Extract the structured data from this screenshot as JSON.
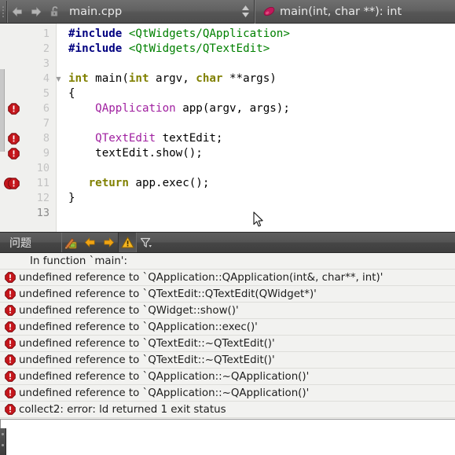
{
  "toolbar": {
    "back_icon": "arrow-left-icon",
    "forward_icon": "arrow-right-icon",
    "lock_icon": "unlocked-padlock-icon",
    "file_name": "main.cpp",
    "file_dropdown_icon": "updown-spinner-icon",
    "symbol_icon": "function-symbol-icon",
    "symbol_name": "main(int, char **): int"
  },
  "editor": {
    "current_line": 13,
    "fold_marker_line": 4,
    "error_lines": [
      6,
      8,
      9,
      11
    ],
    "double_error_lines": [
      11
    ],
    "lines": [
      {
        "n": 1,
        "tokens": [
          {
            "t": "#include ",
            "c": "tok-pp"
          },
          {
            "t": "<QtWidgets/QApplication>",
            "c": "tok-str"
          }
        ]
      },
      {
        "n": 2,
        "tokens": [
          {
            "t": "#include ",
            "c": "tok-pp"
          },
          {
            "t": "<QtWidgets/QTextEdit>",
            "c": "tok-str"
          }
        ]
      },
      {
        "n": 3,
        "tokens": []
      },
      {
        "n": 4,
        "tokens": [
          {
            "t": "int",
            "c": "tok-kw"
          },
          {
            "t": " main(",
            "c": "tok-pln"
          },
          {
            "t": "int",
            "c": "tok-kw"
          },
          {
            "t": " argv, ",
            "c": "tok-pln"
          },
          {
            "t": "char",
            "c": "tok-kw"
          },
          {
            "t": " **args)",
            "c": "tok-pln"
          }
        ]
      },
      {
        "n": 5,
        "tokens": [
          {
            "t": "{",
            "c": "tok-pln"
          }
        ]
      },
      {
        "n": 6,
        "tokens": [
          {
            "t": "    ",
            "c": "tok-pln"
          },
          {
            "t": "QApplication",
            "c": "tok-type"
          },
          {
            "t": " app(argv, args);",
            "c": "tok-pln"
          }
        ]
      },
      {
        "n": 7,
        "tokens": []
      },
      {
        "n": 8,
        "tokens": [
          {
            "t": "    ",
            "c": "tok-pln"
          },
          {
            "t": "QTextEdit",
            "c": "tok-type"
          },
          {
            "t": " textEdit;",
            "c": "tok-pln"
          }
        ]
      },
      {
        "n": 9,
        "tokens": [
          {
            "t": "    textEdit.show();",
            "c": "tok-pln"
          }
        ]
      },
      {
        "n": 10,
        "tokens": []
      },
      {
        "n": 11,
        "tokens": [
          {
            "t": "   ",
            "c": "tok-pln"
          },
          {
            "t": "return",
            "c": "tok-kw"
          },
          {
            "t": " app.exec();",
            "c": "tok-pln"
          }
        ]
      },
      {
        "n": 12,
        "tokens": [
          {
            "t": "}",
            "c": "tok-pln"
          }
        ]
      },
      {
        "n": 13,
        "tokens": []
      }
    ]
  },
  "issues_panel": {
    "title": "问题",
    "tools": [
      {
        "name": "clear-issues-icon",
        "icon": "pencil-eraser"
      },
      {
        "name": "previous-issue-icon",
        "icon": "arrow-left"
      },
      {
        "name": "next-issue-icon",
        "icon": "arrow-right"
      },
      {
        "name": "show-warnings-icon",
        "icon": "warning-triangle",
        "pressed": true
      },
      {
        "name": "filter-issues-icon",
        "icon": "funnel"
      }
    ],
    "rows": [
      {
        "severity": "none",
        "text": "In function `main':"
      },
      {
        "severity": "error",
        "text": "undefined reference to `QApplication::QApplication(int&, char**, int)'"
      },
      {
        "severity": "error",
        "text": "undefined reference to `QTextEdit::QTextEdit(QWidget*)'"
      },
      {
        "severity": "error",
        "text": "undefined reference to `QWidget::show()'"
      },
      {
        "severity": "error",
        "text": "undefined reference to `QApplication::exec()'"
      },
      {
        "severity": "error",
        "text": "undefined reference to `QTextEdit::~QTextEdit()'"
      },
      {
        "severity": "error",
        "text": "undefined reference to `QTextEdit::~QTextEdit()'"
      },
      {
        "severity": "error",
        "text": "undefined reference to `QApplication::~QApplication()'"
      },
      {
        "severity": "error",
        "text": "undefined reference to `QApplication::~QApplication()'"
      },
      {
        "severity": "error",
        "text": "collect2: error: ld returned 1 exit status"
      }
    ]
  },
  "colors": {
    "toolbar_bg": "#5c5c5c",
    "editor_bg": "#ffffff",
    "gutter_bg": "#f0f0ee",
    "error_red": "#c5161c",
    "keyword_olive": "#808000",
    "string_green": "#008000",
    "preproc_navy": "#000080",
    "type_purple": "#a020a0",
    "panel_row_bg": "#f2f2f0",
    "accent_orange": "#f0a30a"
  }
}
